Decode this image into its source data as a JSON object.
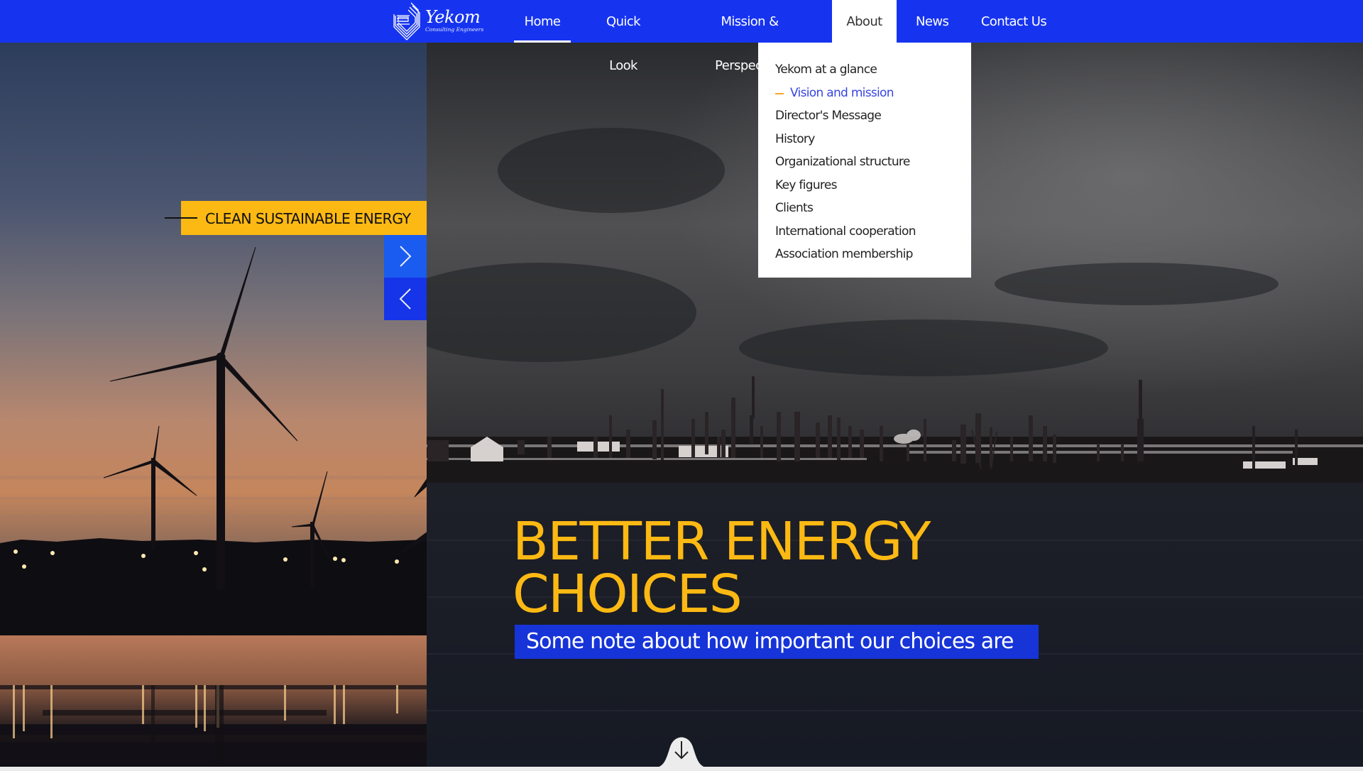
{
  "brand": {
    "name": "Yekom",
    "tagline": "Consulting Engineers",
    "colors": {
      "nav_blue": "#1634f0",
      "accent_yellow": "#fdb913",
      "subtitle_blue": "#1634d8",
      "selected_link": "#3746e0"
    }
  },
  "nav": {
    "items": [
      {
        "label": "Home",
        "state": "current"
      },
      {
        "label": "Quick Look"
      },
      {
        "label": "Mission & Perspective"
      },
      {
        "label": "About",
        "state": "open"
      },
      {
        "label": "News"
      },
      {
        "label": "Contact Us"
      }
    ]
  },
  "about_menu": {
    "items": [
      {
        "label": "Yekom at a glance"
      },
      {
        "label": "Vision and mission",
        "selected": true
      },
      {
        "label": "Director's Message"
      },
      {
        "label": "History"
      },
      {
        "label": "Organizational structure"
      },
      {
        "label": "Key figures"
      },
      {
        "label": "Clients"
      },
      {
        "label": "International cooperation"
      },
      {
        "label": "Association membership"
      }
    ]
  },
  "slider": {
    "tag": "CLEAN SUSTAINABLE ENERGY",
    "next_icon": "chevron-right-icon",
    "prev_icon": "chevron-left-icon"
  },
  "hero": {
    "headline_line1": "BETTER ENERGY",
    "headline_line2": "CHOICES",
    "subtitle": "Some note about how important our choices are",
    "scroll_icon": "arrow-down-icon"
  }
}
